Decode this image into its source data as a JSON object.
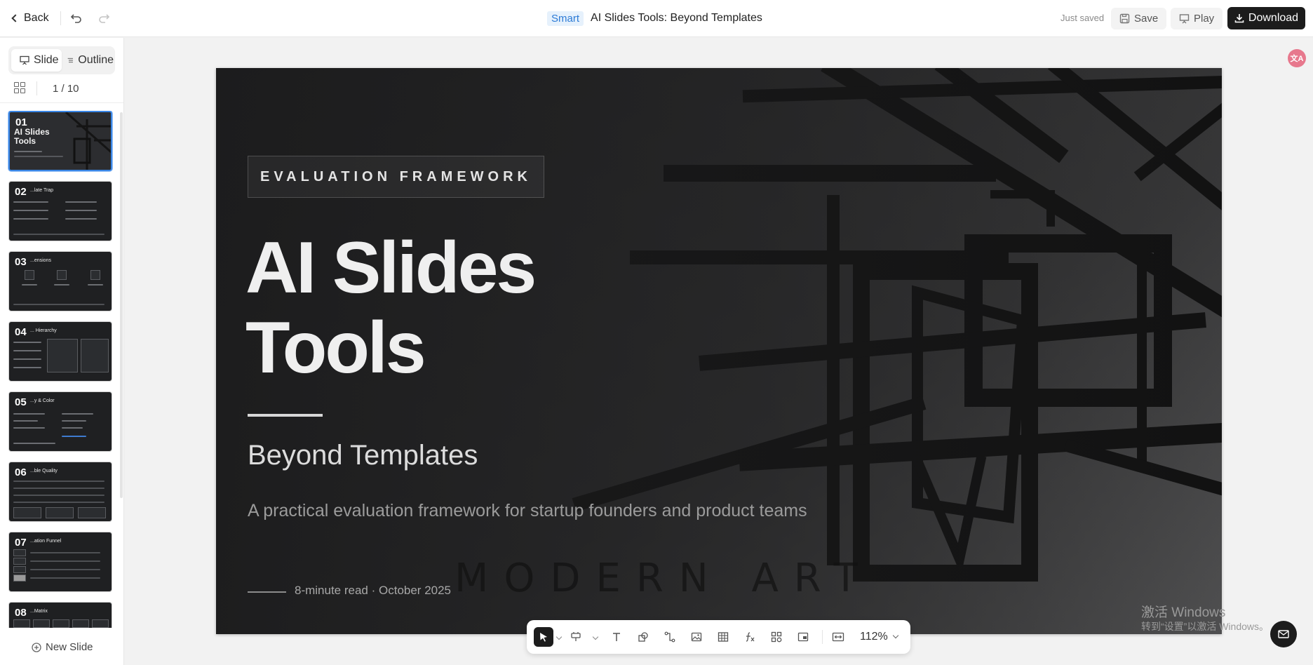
{
  "topbar": {
    "back_label": "Back",
    "smart_badge": "Smart",
    "doc_title": "AI Slides Tools: Beyond Templates",
    "save_status": "Just saved",
    "save_label": "Save",
    "play_label": "Play",
    "download_label": "Download"
  },
  "sidebar": {
    "tab_slide": "Slide",
    "tab_outline": "Outline",
    "page_counter": "1 / 10",
    "new_slide_label": "New Slide",
    "thumbnails": [
      {
        "num": "01",
        "title": "AI Slides Tools"
      },
      {
        "num": "02",
        "title": "...late Trap"
      },
      {
        "num": "03",
        "title": "...ensions"
      },
      {
        "num": "04",
        "title": "... Hierarchy"
      },
      {
        "num": "05",
        "title": "...y & Color"
      },
      {
        "num": "06",
        "title": "...ble Quality"
      },
      {
        "num": "07",
        "title": "...ation Funnel"
      },
      {
        "num": "08",
        "title": "...Matrix"
      }
    ]
  },
  "slide": {
    "badge": "EVALUATION FRAMEWORK",
    "hero_line1": "AI Slides",
    "hero_line2": "Tools",
    "subtitle": "Beyond Templates",
    "description": "A practical evaluation framework for startup founders and product teams",
    "meta": "8-minute read · October 2025",
    "background_text": "MODERN ART"
  },
  "toolbar": {
    "zoom": "112%"
  },
  "overlay": {
    "windows_line1": "激活 Windows",
    "windows_line2": "转到“设置”以激活 Windows。"
  }
}
